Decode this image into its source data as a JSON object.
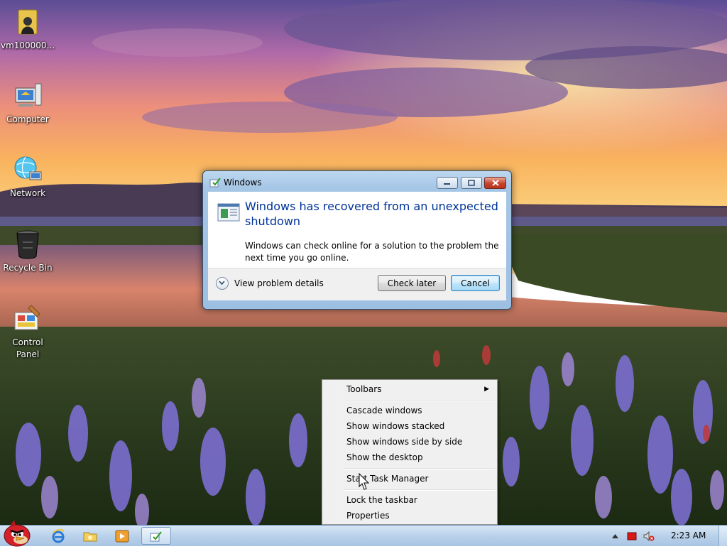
{
  "desktop": {
    "icons": [
      {
        "label": "vm100000...",
        "icon": "user-folder-icon"
      },
      {
        "label": "Computer",
        "icon": "computer-icon"
      },
      {
        "label": "Network",
        "icon": "network-icon"
      },
      {
        "label": "Recycle Bin",
        "icon": "recycle-bin-icon"
      },
      {
        "label": "Control\nPanel",
        "icon": "control-panel-icon"
      }
    ]
  },
  "dialog": {
    "title": "Windows",
    "headline": "Windows has recovered from an unexpected shutdown",
    "body": "Windows can check online for a solution to the problem the next time you go online.",
    "details_label": "View problem details",
    "buttons": {
      "check_later": "Check later",
      "cancel": "Cancel"
    },
    "caption_buttons": [
      "minimize",
      "restore",
      "close"
    ]
  },
  "context_menu": {
    "items": [
      {
        "label": "Toolbars",
        "submenu": true
      },
      {
        "label": "Cascade windows"
      },
      {
        "label": "Show windows stacked"
      },
      {
        "label": "Show windows side by side"
      },
      {
        "label": "Show the desktop"
      },
      {
        "label": "Start Task Manager"
      },
      {
        "label": "Lock the taskbar"
      },
      {
        "label": "Properties"
      }
    ]
  },
  "taskbar": {
    "start_icon": "angry-bird-start-icon",
    "pinned": [
      "internet-explorer-icon",
      "explorer-folder-icon",
      "media-player-icon",
      "windows-error-report-icon"
    ],
    "tray_icons": [
      "show-hidden-icons-chevron",
      "action-center-flag-icon",
      "volume-muted-icon"
    ],
    "clock": "2:23 AM"
  },
  "colors": {
    "dialog_headline": "#003399",
    "taskbar": "#b9d1ea",
    "menu_bg": "#f0f0f0"
  }
}
